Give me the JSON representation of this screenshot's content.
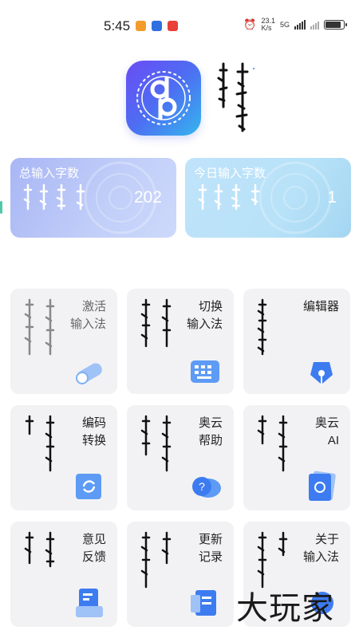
{
  "status_bar": {
    "time": "5:45",
    "net_speed_value": "23.1",
    "net_speed_unit": "K/s",
    "signal_label": "5G",
    "battery_level": 0.85
  },
  "header": {
    "app_logo": "dq-logo-icon"
  },
  "stats": {
    "total": {
      "label": "总输入字数",
      "value": "202"
    },
    "today": {
      "label": "今日输入字数",
      "value": "1"
    }
  },
  "tiles": [
    {
      "label": "激活\n输入法",
      "icon": "pill-toggle-icon"
    },
    {
      "label": "切换\n输入法",
      "icon": "keyboard-icon"
    },
    {
      "label": "编辑器",
      "icon": "pen-nib-icon"
    },
    {
      "label": "编码\n转换",
      "icon": "convert-icon"
    },
    {
      "label": "奥云\n帮助",
      "icon": "help-chat-icon"
    },
    {
      "label": "奥云\nAI",
      "icon": "ai-card-icon"
    },
    {
      "label": "意见\n反馈",
      "icon": "feedback-icon"
    },
    {
      "label": "更新\n记录",
      "icon": "update-log-icon"
    },
    {
      "label": "关于\n输入法",
      "icon": "about-icon"
    }
  ],
  "watermark": {
    "text": "大玩家"
  },
  "colors": {
    "accent_purple": "#6a4cf5",
    "accent_blue": "#35b6ee",
    "tile_bg": "#f2f2f4",
    "icon_blue": "#3d7cf0"
  }
}
